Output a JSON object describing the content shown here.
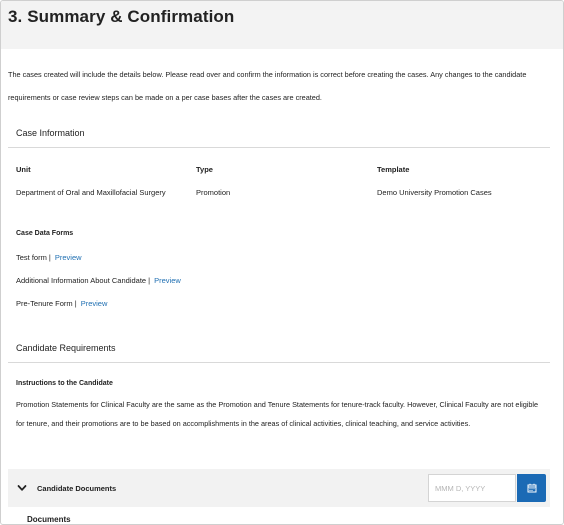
{
  "page": {
    "title": "3. Summary & Confirmation",
    "intro": "The cases created will include the details below. Please read over and confirm the information is correct before creating the cases. Any changes to the candidate requirements or case review steps can be made on a per case bases after the cases are created."
  },
  "case_information": {
    "heading": "Case Information",
    "columns": [
      {
        "label": "Unit",
        "value": "Department of Oral and Maxillofacial Surgery"
      },
      {
        "label": "Type",
        "value": "Promotion"
      },
      {
        "label": "Template",
        "value": "Demo University Promotion Cases"
      }
    ],
    "forms_heading": "Case Data Forms",
    "forms": [
      {
        "name": "Test form |",
        "link": "Preview"
      },
      {
        "name": "Additional Information About Candidate |",
        "link": "Preview"
      },
      {
        "name": "Pre-Tenure Form |",
        "link": "Preview"
      }
    ]
  },
  "candidate_requirements": {
    "heading": "Candidate Requirements",
    "instructions_heading": "Instructions to the Candidate",
    "instructions": "Promotion Statements for Clinical Faculty are the same as the Promotion and Tenure Statements for tenure-track faculty.  However, Clinical Faculty are not eligible for tenure, and their promotions are to be based on accomplishments in the areas of clinical activities, clinical teaching, and service activities."
  },
  "candidate_documents": {
    "label": "Candidate Documents",
    "date_placeholder": "MMM D, YYYY",
    "next_label": "Documents"
  },
  "colors": {
    "link": "#1f6fb2",
    "button": "#1b6ab5",
    "header_bg": "#f3f3f3"
  },
  "icons": {
    "chevron": "chevron-down-icon",
    "calendar": "calendar-icon"
  }
}
